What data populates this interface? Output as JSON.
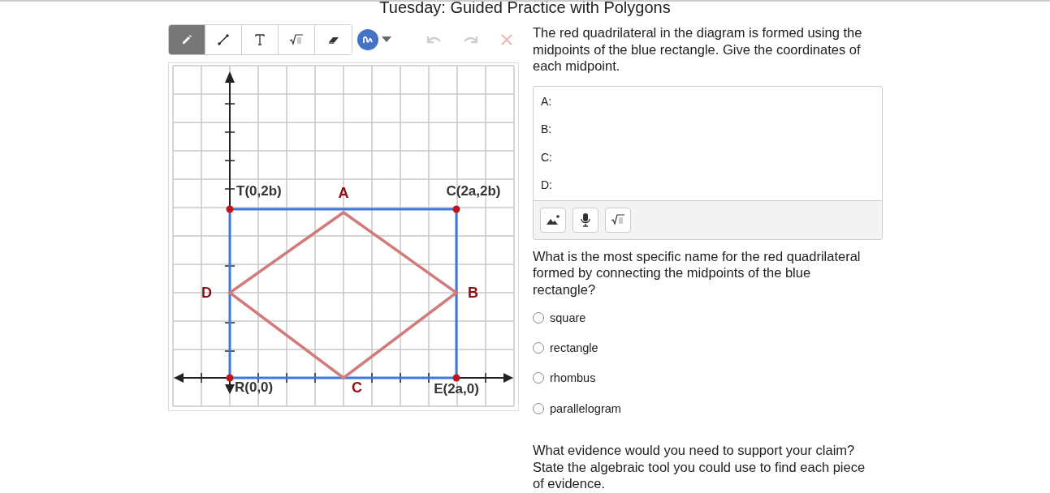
{
  "title": "Tuesday: Guided Practice with Polygons",
  "toolbar": {
    "tools": [
      {
        "kind": "pencil",
        "selected": true
      },
      {
        "kind": "line",
        "selected": false
      },
      {
        "kind": "text",
        "selected": false
      },
      {
        "kind": "math",
        "selected": false
      },
      {
        "kind": "eraser",
        "selected": false
      }
    ],
    "actions": [
      {
        "kind": "undo",
        "disabled": true
      },
      {
        "kind": "redo",
        "disabled": true
      },
      {
        "kind": "clear",
        "disabled": true
      }
    ]
  },
  "diagram": {
    "labels": [
      {
        "text": "T(0,2b)",
        "kind": "coord"
      },
      {
        "text": "A",
        "kind": "point"
      },
      {
        "text": "C(2a,2b)",
        "kind": "coord"
      },
      {
        "text": "D",
        "kind": "point"
      },
      {
        "text": "B",
        "kind": "point"
      },
      {
        "text": "R(0,0)",
        "kind": "coord"
      },
      {
        "text": "C",
        "kind": "point"
      },
      {
        "text": "E(2a,0)",
        "kind": "coord"
      }
    ]
  },
  "question1": {
    "text": "The red quadrilateral in the diagram is formed using the midpoints of the blue rectangle. Give the coordinates of each midpoint.",
    "answer_lines": [
      "A:",
      "B:",
      "C:",
      "D:"
    ]
  },
  "question2": {
    "text": "What is the most specific name for the red quadrilateral formed by connecting the midpoints of the blue rectangle?",
    "options": [
      {
        "label": "square",
        "selected": false
      },
      {
        "label": "rectangle",
        "selected": false
      },
      {
        "label": "rhombus",
        "selected": false
      },
      {
        "label": "parallelogram",
        "selected": false
      }
    ]
  },
  "question3": {
    "text": "What evidence would you need to support your claim? State the algebraic tool you could use to find each piece of evidence."
  }
}
